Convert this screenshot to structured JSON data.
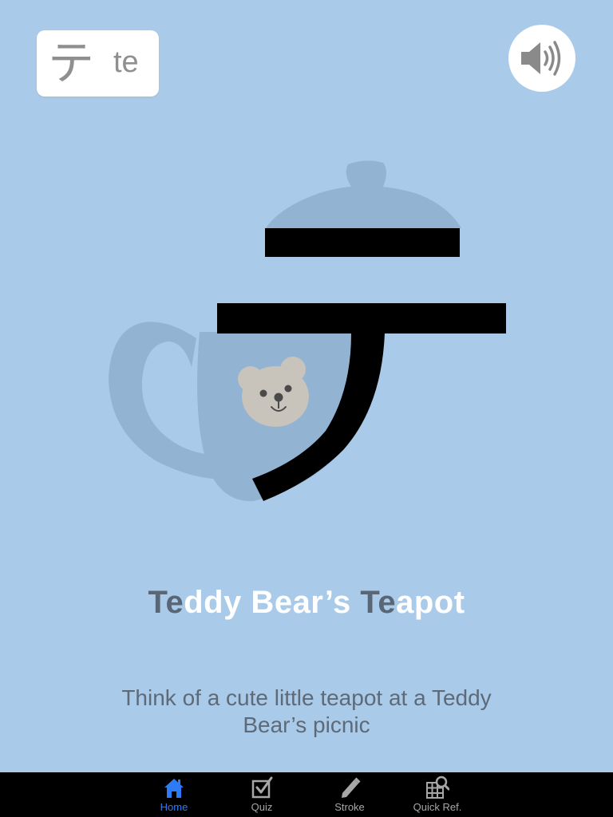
{
  "kana_card": {
    "character": "テ",
    "romaji": "te"
  },
  "sound_button": {
    "icon": "speaker-icon"
  },
  "mnemonic": {
    "title_parts": {
      "p1": "Te",
      "p2": "ddy Bear’s ",
      "p3": "Te",
      "p4": "apot"
    },
    "description": "Think of a cute little teapot at a Teddy Bear’s picnic"
  },
  "colors": {
    "background": "#a9cbe9",
    "teapot": "#92b3d2",
    "highlight_text": "#5a6675",
    "active_tab": "#2d7cf6"
  },
  "tabbar": {
    "tabs": [
      {
        "label": "Home",
        "icon": "home-icon",
        "active": true
      },
      {
        "label": "Quiz",
        "icon": "quiz-checkbox-icon",
        "active": false
      },
      {
        "label": "Stroke",
        "icon": "pencil-icon",
        "active": false
      },
      {
        "label": "Quick Ref.",
        "icon": "grid-search-icon",
        "active": false
      }
    ]
  }
}
